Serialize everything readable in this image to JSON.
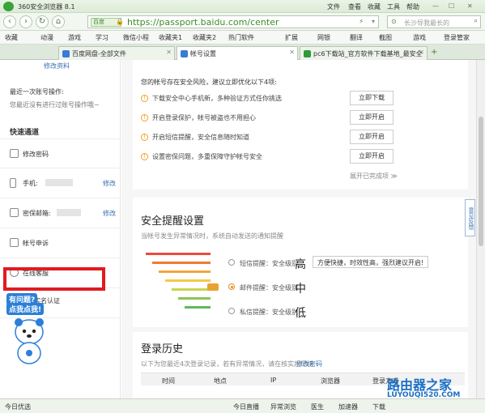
{
  "window": {
    "title": "360安全浏览器 8.1",
    "menu": [
      "文件",
      "查看",
      "收藏",
      "工具",
      "帮助"
    ]
  },
  "address": {
    "channel": "百度",
    "url": "https://passport.baidu.com/center",
    "search_placeholder": "长沙导我最长的",
    "lock_icon": "lock-icon"
  },
  "favorites": {
    "label": "收藏",
    "items": [
      "动漫",
      "游戏",
      "学习",
      "微信小程",
      "收藏夹1",
      "收藏夹2",
      "热门软件",
      "扩展",
      "网银",
      "翻译",
      "截图",
      "游戏",
      "登录管家"
    ]
  },
  "tabs": [
    {
      "label": "百度网盘-全部文件",
      "color": "#3a7bd5"
    },
    {
      "label": "帐号设置",
      "color": "#3a7bd5"
    },
    {
      "label": "pc6下载站_官方软件下载基地_最安全",
      "color": "#2e9b3a"
    }
  ],
  "left": {
    "profile_link": "修改资料",
    "last_op_title": "最近一次账号操作:",
    "last_op_text": "您最近没有进行过账号操作哦~",
    "quick_title": "快速通道",
    "items": [
      {
        "label": "修改密码",
        "edit": ""
      },
      {
        "label": "手机:",
        "edit": "修改"
      },
      {
        "label": "密保邮箱:",
        "edit": "修改"
      },
      {
        "label": "帐号申诉",
        "edit": ""
      },
      {
        "label": "在线客服",
        "edit": ""
      },
      {
        "label": "钱包实名认证",
        "edit": ""
      }
    ],
    "mascot_text_1": "有问题?",
    "mascot_text_2": "点我点我!"
  },
  "security": {
    "heading": "您的帐号存在安全风险，建议立即优化以下4项:",
    "items": [
      {
        "text": "下载安全中心手机新，多种验证方式任你挑选",
        "button": "立即下载"
      },
      {
        "text": "开启登录保护，帐号被盗也不用担心",
        "button": "立即开启"
      },
      {
        "text": "开启短信提醒，安全信息随时知道",
        "button": "立即开启"
      },
      {
        "text": "设置密保问题，多重保障守护帐号安全",
        "button": "立即开启"
      }
    ],
    "more": "展开已完成项 ≫"
  },
  "reminder": {
    "title": "安全提醒设置",
    "desc": "当帐号发生异常情况时，系统自动发送的通知提醒",
    "options": [
      {
        "label": "短信提醒：安全级别",
        "level": "高",
        "selected": false
      },
      {
        "label": "邮件提醒：安全级别",
        "level": "中",
        "selected": true
      },
      {
        "label": "私信提醒：安全级别",
        "level": "低",
        "selected": false
      }
    ],
    "tooltip": "方便快捷，时效性高，强烈建议开启!",
    "bar_colors": [
      "#e94b3c",
      "#ee7a3a",
      "#f2a63d",
      "#f4c84a",
      "#c9d44f",
      "#8cc653",
      "#5fb95a"
    ]
  },
  "login_history": {
    "title": "登录历史",
    "desc": "以下为您最近4次登录记录，若有异常情况，请在核实后尽快",
    "link": "修改密码",
    "columns": [
      "时间",
      "地点",
      "IP",
      "浏览器",
      "登录方式"
    ]
  },
  "feedback": "意见反馈",
  "statusbar": {
    "items": [
      "今日优选",
      "今日直播",
      "异常浏览",
      "医生",
      "加速器",
      "下载"
    ]
  },
  "watermark": {
    "line1": "路由器之家",
    "line2": "LUYOUQI520.COM"
  }
}
